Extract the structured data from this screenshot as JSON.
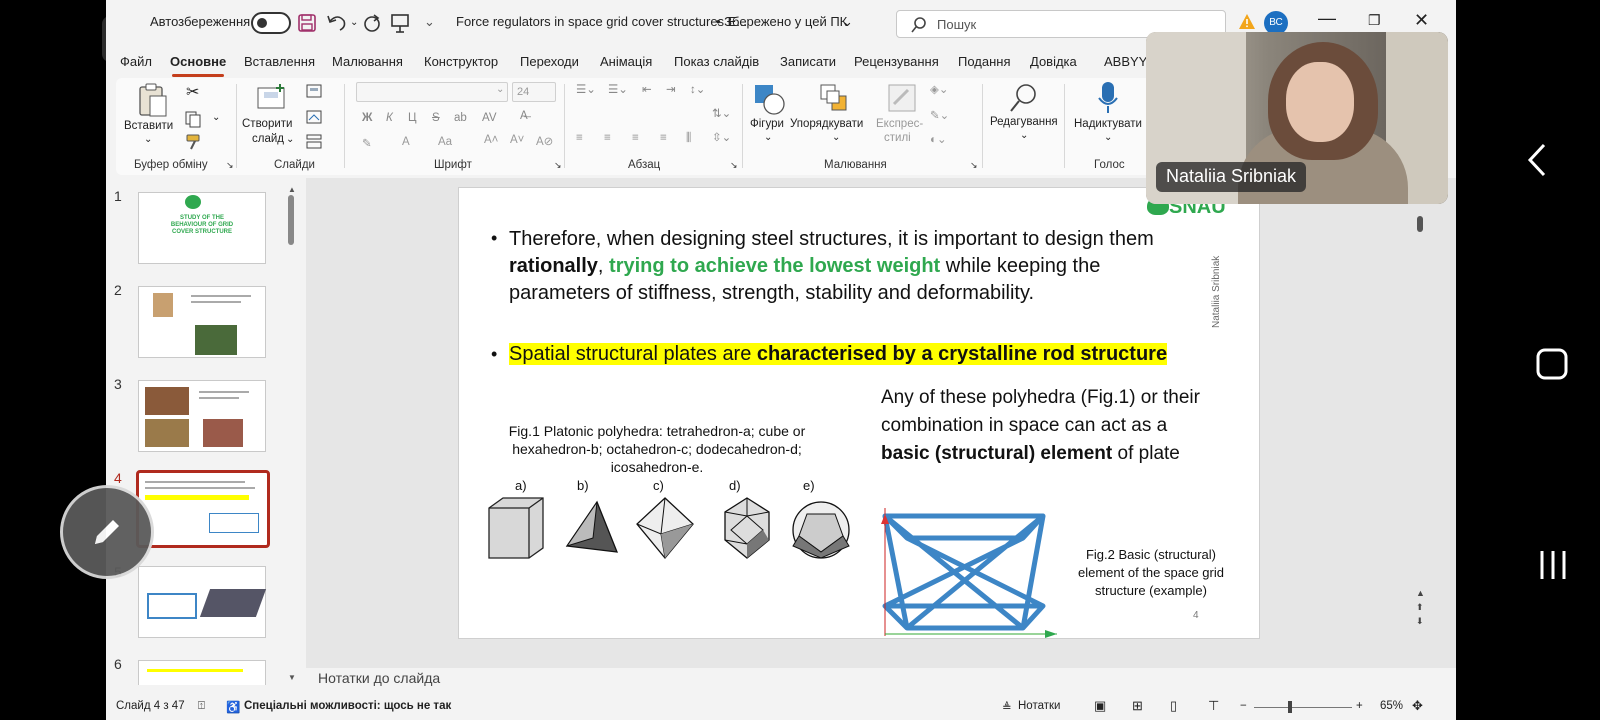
{
  "titlebar": {
    "autosave_label": "Автозбереження",
    "doc_title": "Force regulators in space grid cover structures E...",
    "saved_status": "• Збережено у цей ПК",
    "search_placeholder": "Пошук",
    "user_initials": "ВС"
  },
  "tabs": [
    "Файл",
    "Основне",
    "Вставлення",
    "Малювання",
    "Конструктор",
    "Переходи",
    "Анімація",
    "Показ слайдів",
    "Записати",
    "Рецензування",
    "Подання",
    "Довідка",
    "ABBYY F"
  ],
  "active_tab": "Основне",
  "ribbon": {
    "paste": "Вставити",
    "clipboard_group": "Буфер обміну",
    "new_slide_l1": "Створити",
    "new_slide_l2": "слайд",
    "slides_group": "Слайди",
    "font_size": "24",
    "font_group": "Шрифт",
    "paragraph_group": "Абзац",
    "shapes": "Фігури",
    "arrange": "Упорядкувати",
    "styles_l1": "Експрес-",
    "styles_l2": "стилі",
    "drawing_group": "Малювання",
    "editing": "Редагування",
    "dictate": "Надиктувати",
    "voice_group": "Голос"
  },
  "thumbnails": {
    "numbers": [
      "1",
      "2",
      "3",
      "4",
      "5",
      "6"
    ],
    "selected": "4",
    "slide1_title_l1": "STUDY OF THE",
    "slide1_title_l2": "BEHAVIOUR OF GRID",
    "slide1_title_l3": "COVER STRUCTURE"
  },
  "slide": {
    "logo": "SNAU",
    "bullet1_pre": "Therefore, when designing steel structures, it is important to design them ",
    "bullet1_bold": "rationally",
    "bullet1_comma": ", ",
    "bullet1_green": "trying to achieve the lowest weight",
    "bullet1_post": " while keeping the parameters of stiffness, strength, stability and deformability.",
    "bullet2_pre": "Spatial structural plates are ",
    "bullet2_bold": "characterised by a crystalline rod structure",
    "fig1_caption": "Fig.1 Platonic polyhedra: tetrahedron-a; cube or hexahedron-b; octahedron-c; dodecahedron-d; icosahedron-e.",
    "poly_labels": [
      "a)",
      "b)",
      "c)",
      "d)",
      "e)"
    ],
    "right_text_pre": "Any of these polyhedra (Fig.1) or their combination in space can act as a ",
    "right_text_bold": "basic (structural) element",
    "right_text_post": " of plate",
    "fig2_caption": "Fig.2 Basic (structural) element of the space grid structure (example)",
    "vertical_author": "Nataliia Sribniak",
    "page_number": "4"
  },
  "notes_placeholder": "Нотатки до слайда",
  "status": {
    "slide_counter": "Слайд 4 з 47",
    "accessibility": "Спеціальні можливості: щось не так",
    "notes": "Нотатки",
    "zoom": "65%"
  },
  "video": {
    "participant_name": "Nataliia Sribniak"
  },
  "colors": {
    "accent": "#c43e1c",
    "green": "#2fa84f",
    "highlight": "#ffff00",
    "frame_blue": "#3d86c6"
  },
  "icons": [
    "microphone-muted-icon",
    "save-icon",
    "undo-icon",
    "redo-icon",
    "present-icon",
    "search-icon",
    "warning-icon",
    "minimize-icon",
    "restore-icon",
    "close-icon",
    "paste-icon",
    "cut-icon",
    "copy-icon",
    "format-painter-icon",
    "shapes-icon",
    "arrange-icon",
    "quick-styles-icon",
    "find-icon",
    "dictate-microphone-icon",
    "pencil-icon",
    "back-chevron-icon",
    "home-square-icon",
    "recent-apps-icon"
  ]
}
